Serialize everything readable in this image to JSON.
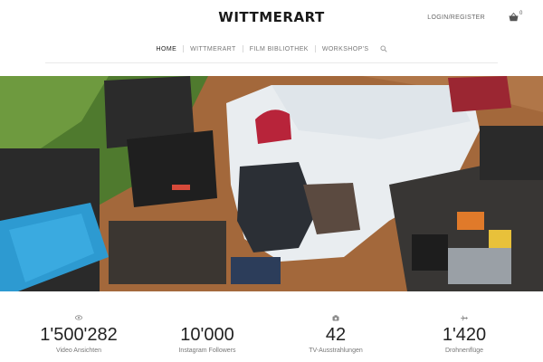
{
  "brand": {
    "name": "WITTMERART"
  },
  "header": {
    "login_label": "LOGIN/REGISTER",
    "cart_count": "0"
  },
  "nav": {
    "items": [
      {
        "label": "HOME",
        "active": true
      },
      {
        "label": "WITTMERART",
        "active": false
      },
      {
        "label": "FILM BIBLIOTHEK",
        "active": false
      },
      {
        "label": "WORKSHOP'S",
        "active": false
      }
    ],
    "search_icon": "search-icon"
  },
  "hero": {
    "image": "photo-gear-flatlay",
    "icon_names": [
      "open-camera-case",
      "cap",
      "pillow",
      "laptop",
      "drone-case"
    ]
  },
  "stats": [
    {
      "value": "1'500'282",
      "label": "Video Ansichten",
      "icon": "eye-icon"
    },
    {
      "value": "10'000",
      "label": "Instagram Followers",
      "icon": ""
    },
    {
      "value": "42",
      "label": "TV-Ausstrahlungen",
      "icon": "camera-icon"
    },
    {
      "value": "1'420",
      "label": "Drohnenflüge",
      "icon": "plane-icon"
    }
  ],
  "colors": {
    "text": "#222222",
    "muted": "#777777",
    "divider": "#e9e9e9"
  }
}
